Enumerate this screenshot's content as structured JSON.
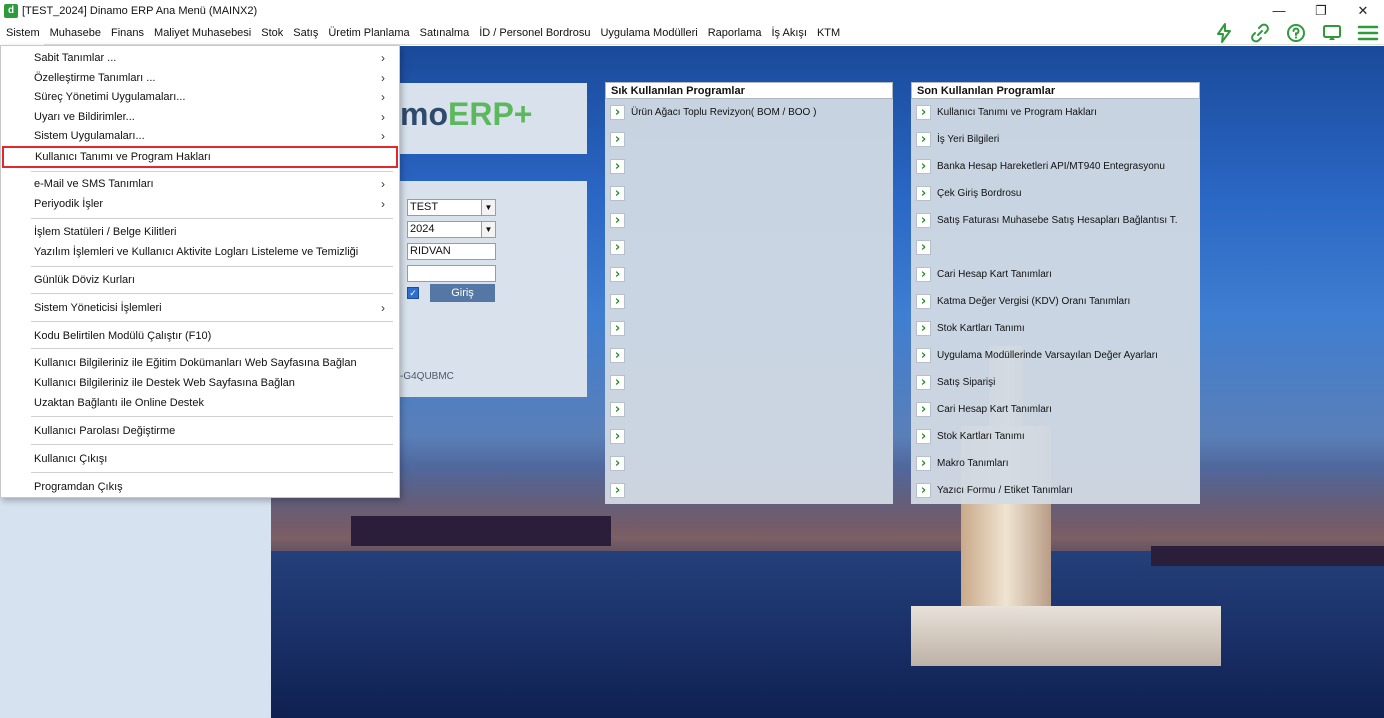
{
  "window": {
    "title": "[TEST_2024] Dinamo ERP Ana Menü (MAINX2)",
    "app_icon_letter": "d",
    "controls": [
      "—",
      "❐",
      "✕"
    ]
  },
  "menubar": {
    "items": [
      "Sistem",
      "Muhasebe",
      "Finans",
      "Maliyet Muhasebesi",
      "Stok",
      "Satış",
      "Üretim Planlama",
      "Satınalma",
      "İD / Personel Bordrosu",
      "Uygulama Modülleri",
      "Raporlama",
      "İş Akışı",
      "KTM"
    ],
    "toolbar_icons": [
      "lightning-icon",
      "link-icon",
      "help-icon",
      "screen-icon",
      "hamburger-icon"
    ],
    "accent_color": "#2e9b3a"
  },
  "dropdown": {
    "items": [
      {
        "label": "Sabit Tanımlar ...",
        "submenu": true
      },
      {
        "label": "Özelleştirme Tanımları ...",
        "submenu": true
      },
      {
        "label": "Süreç Yönetimi Uygulamaları...",
        "submenu": true
      },
      {
        "label": "Uyarı ve Bildirimler...",
        "submenu": true
      },
      {
        "label": "Sistem Uygulamaları...",
        "submenu": true
      },
      {
        "label": "Kullanıcı Tanımı ve Program Hakları",
        "submenu": false,
        "highlighted": true
      },
      {
        "label": "e-Mail ve SMS Tanımları",
        "submenu": true
      },
      {
        "label": "Periyodik İşler",
        "submenu": true
      },
      {
        "label": "İşlem Statüleri / Belge Kilitleri",
        "submenu": false
      },
      {
        "label": "Yazılım İşlemleri ve Kullanıcı Aktivite Logları Listeleme ve Temizliği",
        "submenu": false
      },
      {
        "label": "Günlük Döviz Kurları",
        "submenu": false
      },
      {
        "label": "Sistem Yöneticisi İşlemleri",
        "submenu": true
      },
      {
        "label": "Kodu Belirtilen Modülü Çalıştır (F10)",
        "submenu": false
      },
      {
        "label": "Kullanıcı Bilgileriniz ile Eğitim Dokümanları Web Sayfasına Bağlan",
        "submenu": false
      },
      {
        "label": "Kullanıcı Bilgileriniz ile Destek Web Sayfasına Bağlan",
        "submenu": false
      },
      {
        "label": "Uzaktan Bağlantı ile Online Destek",
        "submenu": false
      },
      {
        "label": "Kullanıcı Parolası Değiştirme",
        "submenu": false
      },
      {
        "label": "Kullanıcı Çıkışı",
        "submenu": false
      },
      {
        "label": "Programdan Çıkış",
        "submenu": false
      }
    ],
    "chevron": "›",
    "highlight_color": "#e0282e"
  },
  "logo": {
    "part1": "mo",
    "part2": "ERP+"
  },
  "login": {
    "company_value": "TEST",
    "year_value": "2024",
    "user_value": "RIDVAN",
    "password_value": "",
    "remember_checked": true,
    "login_button": "Giriş",
    "machine_code": "-G4QUBMC"
  },
  "frequent_programs": {
    "title": "Sık Kullanılan Programlar",
    "items": [
      "Ürün Ağacı Toplu Revizyon( BOM / BOO )",
      "",
      "",
      "",
      "",
      "",
      "",
      "",
      "",
      "",
      "",
      "",
      "",
      "",
      ""
    ]
  },
  "recent_programs": {
    "title": "Son Kullanılan Programlar",
    "items": [
      "Kullanıcı Tanımı ve Program Hakları",
      "İş Yeri Bilgileri",
      "Banka Hesap Hareketleri API/MT940 Entegrasyonu",
      "Çek Giriş Bordrosu",
      "Satış Faturası Muhasebe Satış Hesapları Bağlantısı T.",
      "",
      "Cari Hesap Kart Tanımları",
      "Katma Değer Vergisi (KDV) Oranı Tanımları",
      "Stok Kartları Tanımı",
      "Uygulama Modüllerinde Varsayılan Değer Ayarları",
      "Satış Siparişi",
      "Cari Hesap Kart Tanımları",
      "Stok Kartları Tanımı",
      "Makro Tanımları",
      "Yazıcı Formu / Etiket Tanımları"
    ]
  }
}
